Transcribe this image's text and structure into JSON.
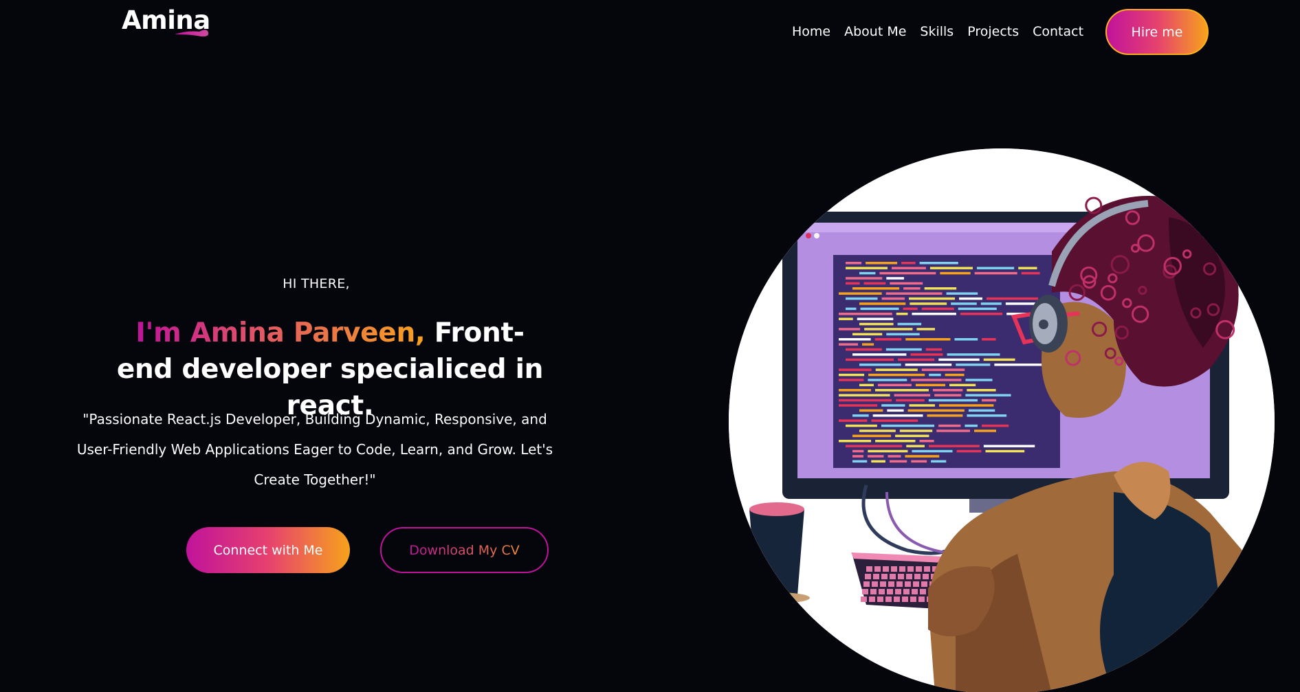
{
  "header": {
    "logo_text": "Amina",
    "nav": [
      "Home",
      "About Me",
      "Skills",
      "Projects",
      "Contact"
    ],
    "hire_label": "Hire me"
  },
  "hero": {
    "greeting": "HI THERE,",
    "name_part": "I'm Amina Parveen,",
    "title_part": "Front-end developer specialiced in react.",
    "tagline": "\"Passionate React.js Developer, Building Dynamic, Responsive, and User-Friendly Web Applications Eager to Code, Learn, and Grow. Let's Create Together!\"",
    "connect_label": "Connect with Me",
    "cv_label": "Download My CV"
  },
  "illustration": {
    "subject": "developer-at-computer",
    "accent_colors": [
      "#c0139b",
      "#f7a21c",
      "#b48ee0"
    ]
  }
}
